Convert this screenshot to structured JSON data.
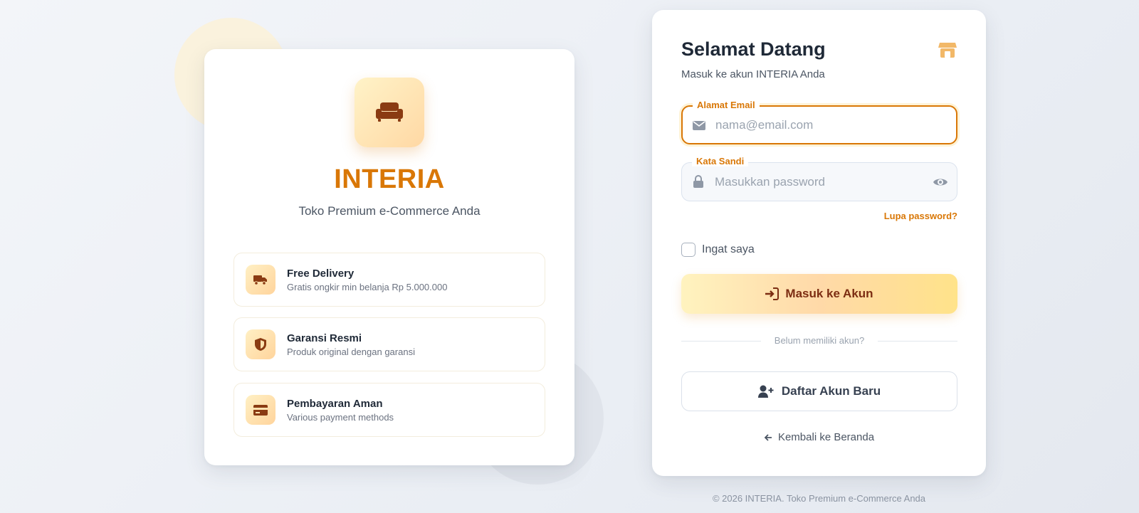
{
  "brand": {
    "name": "INTERIA",
    "tagline": "Toko Premium e-Commerce Anda",
    "logo_icon": "sofa-icon"
  },
  "features": [
    {
      "title": "Free Delivery",
      "description": "Gratis ongkir min belanja Rp 5.000.000",
      "icon": "truck-icon"
    },
    {
      "title": "Garansi Resmi",
      "description": "Produk original dengan garansi",
      "icon": "shield-icon"
    },
    {
      "title": "Pembayaran Aman",
      "description": "Various payment methods",
      "icon": "credit-card-icon"
    }
  ],
  "login": {
    "title": "Selamat Datang",
    "subtitle": "Masuk ke akun INTERIA Anda",
    "header_icon": "store-icon",
    "email": {
      "label": "Alamat Email",
      "placeholder": "nama@email.com",
      "value": ""
    },
    "password": {
      "label": "Kata Sandi",
      "placeholder": "Masukkan password",
      "value": ""
    },
    "forgot_password": "Lupa password?",
    "remember_me": "Ingat saya",
    "submit": "Masuk ke Akun",
    "divider": "Belum memiliki akun?",
    "register": "Daftar Akun Baru",
    "back_home": "Kembali ke Beranda"
  },
  "footer": "© 2026 INTERIA. Toko Premium e-Commerce Anda",
  "colors": {
    "accent": "#d97706",
    "button_text": "#7c2d12",
    "icon_brown": "#8a3b12"
  }
}
